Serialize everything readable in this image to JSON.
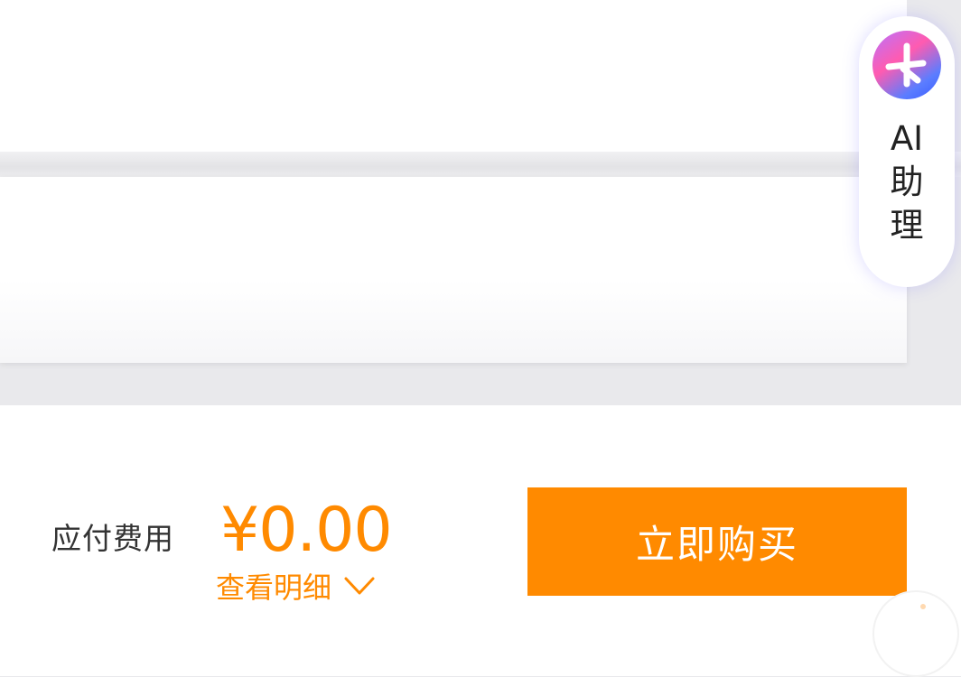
{
  "footer": {
    "fee_label": "应付费用",
    "price": "¥0.00",
    "detail_link": "查看明细",
    "buy_button": "立即购买"
  },
  "assistant": {
    "line1": "AI",
    "line2": "助",
    "line3": "理",
    "icon": "sparkle-icon"
  },
  "colors": {
    "accent": "#ff8a00",
    "page_bg": "#e9e9ec",
    "text": "#333333"
  }
}
